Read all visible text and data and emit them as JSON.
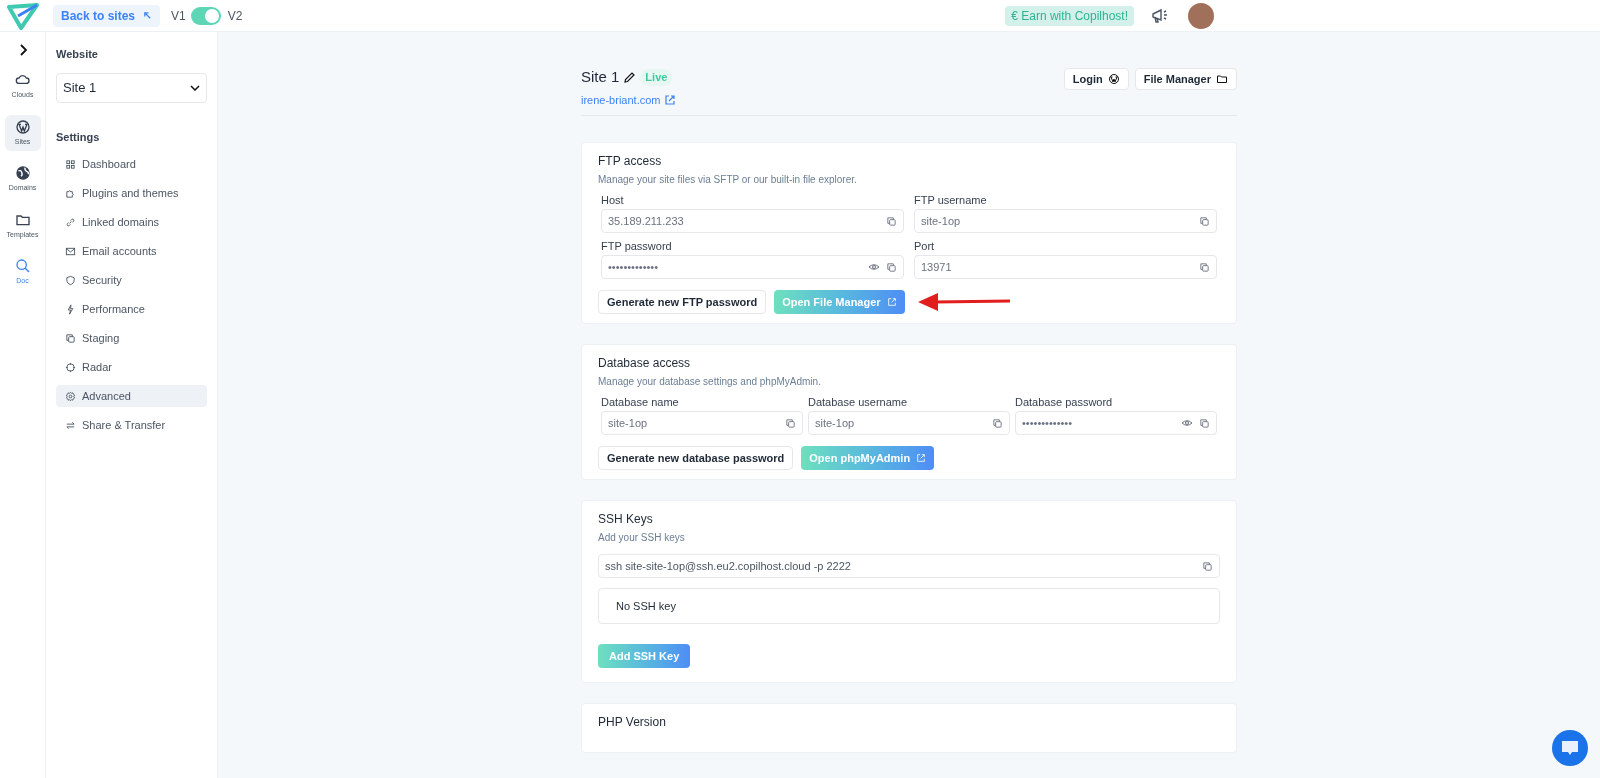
{
  "topbar": {
    "back_link": "Back to sites",
    "toggle": {
      "left_label": "V1",
      "right_label": "V2",
      "on": true
    },
    "earn_badge": "€ Earn with Copilhost!"
  },
  "rail": {
    "items": [
      {
        "label": "Clouds",
        "kind": "cloud",
        "selected": false
      },
      {
        "label": "Sites",
        "kind": "wordpress",
        "selected": true
      },
      {
        "label": "Domains",
        "kind": "globe",
        "selected": false
      },
      {
        "label": "Templates",
        "kind": "folder",
        "selected": false
      },
      {
        "label": "Doc",
        "kind": "search",
        "selected": false
      }
    ]
  },
  "sidebar": {
    "website_heading": "Website",
    "site_select": "Site 1",
    "settings_heading": "Settings",
    "items": [
      {
        "label": "Dashboard",
        "kind": "dashboard",
        "selected": false
      },
      {
        "label": "Plugins and themes",
        "kind": "puzzle",
        "selected": false
      },
      {
        "label": "Linked domains",
        "kind": "link",
        "selected": false
      },
      {
        "label": "Email accounts",
        "kind": "mail",
        "selected": false
      },
      {
        "label": "Security",
        "kind": "shield",
        "selected": false
      },
      {
        "label": "Performance",
        "kind": "bolt",
        "selected": false
      },
      {
        "label": "Staging",
        "kind": "copy",
        "selected": false
      },
      {
        "label": "Radar",
        "kind": "radar",
        "selected": false
      },
      {
        "label": "Advanced",
        "kind": "gear",
        "selected": true
      },
      {
        "label": "Share & Transfer",
        "kind": "swap",
        "selected": false
      }
    ]
  },
  "header": {
    "title": "Site 1",
    "status": "Live",
    "domain": "irene-briant.com",
    "buttons": [
      {
        "label": "Login",
        "kind": "wordpress"
      },
      {
        "label": "File Manager",
        "kind": "folder"
      }
    ]
  },
  "ftp": {
    "title": "FTP access",
    "description": "Manage your site files via SFTP or our built-in file explorer.",
    "fields": [
      {
        "label": "Host",
        "value": "35.189.211.233",
        "secret": false
      },
      {
        "label": "FTP username",
        "value": "site-1op",
        "secret": false
      },
      {
        "label": "FTP password",
        "value": "•••••••••••••",
        "secret": true
      },
      {
        "label": "Port",
        "value": "13971",
        "secret": false
      }
    ],
    "buttons": [
      {
        "label": "Generate new FTP password",
        "kind": "outline"
      },
      {
        "label": "Open File Manager",
        "kind": "gradient"
      }
    ]
  },
  "database": {
    "title": "Database access",
    "description": "Manage your database settings and phpMyAdmin.",
    "fields": [
      {
        "label": "Database name",
        "value": "site-1op",
        "secret": false
      },
      {
        "label": "Database username",
        "value": "site-1op",
        "secret": false
      },
      {
        "label": "Database password",
        "value": "•••••••••••••",
        "secret": true
      }
    ],
    "buttons": [
      {
        "label": "Generate new database password",
        "kind": "outline"
      },
      {
        "label": "Open phpMyAdmin",
        "kind": "gradient"
      }
    ]
  },
  "ssh": {
    "title": "SSH Keys",
    "description": "Add your SSH keys",
    "command": "ssh site-site-1op@ssh.eu2.copilhost.cloud -p 2222",
    "empty_text": "No SSH key",
    "add_button": "Add SSH Key"
  },
  "php": {
    "title": "PHP Version"
  }
}
